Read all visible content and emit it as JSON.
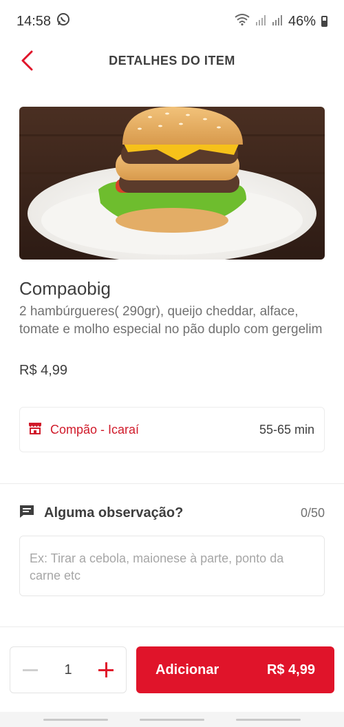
{
  "status_bar": {
    "time": "14:58",
    "battery": "46%",
    "icons": [
      "whatsapp-icon",
      "wifi-icon",
      "signal-icon",
      "signal-icon",
      "battery-icon"
    ]
  },
  "header": {
    "title": "DETALHES DO ITEM",
    "back_icon": "chevron-left-icon"
  },
  "product": {
    "image": "burger-photo",
    "name": "Compaobig",
    "description": "2 hambúrgueres( 290gr), queijo cheddar, alface, tomate e molho especial no pão duplo com gergelim",
    "price": "R$ 4,99"
  },
  "store": {
    "icon": "store-icon",
    "name": "Compão - Icaraí",
    "delivery_time": "55-65 min"
  },
  "observation": {
    "icon": "comment-icon",
    "title": "Alguma observação?",
    "counter": "0/50",
    "value": "",
    "placeholder": "Ex: Tirar a cebola, maionese à parte, ponto da carne etc"
  },
  "footer": {
    "quantity": "1",
    "add_label": "Adicionar",
    "add_price": "R$ 4,99"
  },
  "colors": {
    "accent": "#e0142a",
    "store_text": "#d01a2a",
    "text_primary": "#3e3e3e",
    "text_secondary": "#717171"
  }
}
